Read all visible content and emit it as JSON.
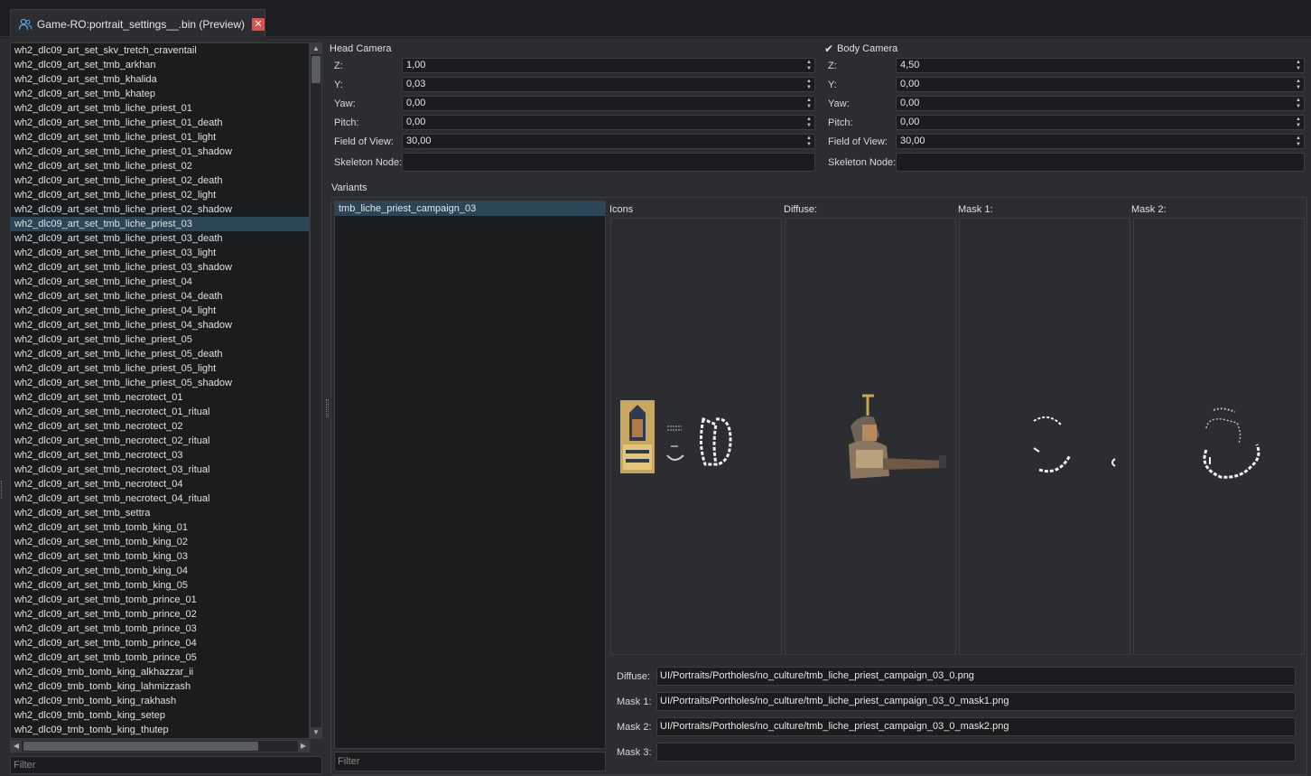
{
  "tab": {
    "title": "Game-RO:portrait_settings__.bin (Preview)",
    "icon": "people-icon",
    "close_glyph": "✕"
  },
  "list": {
    "selected_index": 12,
    "items": [
      "wh2_dlc09_art_set_skv_tretch_craventail",
      "wh2_dlc09_art_set_tmb_arkhan",
      "wh2_dlc09_art_set_tmb_khalida",
      "wh2_dlc09_art_set_tmb_khatep",
      "wh2_dlc09_art_set_tmb_liche_priest_01",
      "wh2_dlc09_art_set_tmb_liche_priest_01_death",
      "wh2_dlc09_art_set_tmb_liche_priest_01_light",
      "wh2_dlc09_art_set_tmb_liche_priest_01_shadow",
      "wh2_dlc09_art_set_tmb_liche_priest_02",
      "wh2_dlc09_art_set_tmb_liche_priest_02_death",
      "wh2_dlc09_art_set_tmb_liche_priest_02_light",
      "wh2_dlc09_art_set_tmb_liche_priest_02_shadow",
      "wh2_dlc09_art_set_tmb_liche_priest_03",
      "wh2_dlc09_art_set_tmb_liche_priest_03_death",
      "wh2_dlc09_art_set_tmb_liche_priest_03_light",
      "wh2_dlc09_art_set_tmb_liche_priest_03_shadow",
      "wh2_dlc09_art_set_tmb_liche_priest_04",
      "wh2_dlc09_art_set_tmb_liche_priest_04_death",
      "wh2_dlc09_art_set_tmb_liche_priest_04_light",
      "wh2_dlc09_art_set_tmb_liche_priest_04_shadow",
      "wh2_dlc09_art_set_tmb_liche_priest_05",
      "wh2_dlc09_art_set_tmb_liche_priest_05_death",
      "wh2_dlc09_art_set_tmb_liche_priest_05_light",
      "wh2_dlc09_art_set_tmb_liche_priest_05_shadow",
      "wh2_dlc09_art_set_tmb_necrotect_01",
      "wh2_dlc09_art_set_tmb_necrotect_01_ritual",
      "wh2_dlc09_art_set_tmb_necrotect_02",
      "wh2_dlc09_art_set_tmb_necrotect_02_ritual",
      "wh2_dlc09_art_set_tmb_necrotect_03",
      "wh2_dlc09_art_set_tmb_necrotect_03_ritual",
      "wh2_dlc09_art_set_tmb_necrotect_04",
      "wh2_dlc09_art_set_tmb_necrotect_04_ritual",
      "wh2_dlc09_art_set_tmb_settra",
      "wh2_dlc09_art_set_tmb_tomb_king_01",
      "wh2_dlc09_art_set_tmb_tomb_king_02",
      "wh2_dlc09_art_set_tmb_tomb_king_03",
      "wh2_dlc09_art_set_tmb_tomb_king_04",
      "wh2_dlc09_art_set_tmb_tomb_king_05",
      "wh2_dlc09_art_set_tmb_tomb_prince_01",
      "wh2_dlc09_art_set_tmb_tomb_prince_02",
      "wh2_dlc09_art_set_tmb_tomb_prince_03",
      "wh2_dlc09_art_set_tmb_tomb_prince_04",
      "wh2_dlc09_art_set_tmb_tomb_prince_05",
      "wh2_dlc09_tmb_tomb_king_alkhazzar_ii",
      "wh2_dlc09_tmb_tomb_king_lahmizzash",
      "wh2_dlc09_tmb_tomb_king_rakhash",
      "wh2_dlc09_tmb_tomb_king_setep",
      "wh2_dlc09_tmb_tomb_king_thutep"
    ],
    "filter_placeholder": "Filter"
  },
  "head_camera": {
    "title": "Head Camera",
    "fields": [
      {
        "label": "Z:",
        "value": "1,00"
      },
      {
        "label": "Y:",
        "value": "0,03"
      },
      {
        "label": "Yaw:",
        "value": "0,00"
      },
      {
        "label": "Pitch:",
        "value": "0,00"
      },
      {
        "label": "Field of View:",
        "value": "30,00"
      }
    ],
    "skeleton_label": "Skeleton Node:"
  },
  "body_camera": {
    "title": "Body Camera",
    "checked": true,
    "fields": [
      {
        "label": "Z:",
        "value": "4,50"
      },
      {
        "label": "Y:",
        "value": "0,00"
      },
      {
        "label": "Yaw:",
        "value": "0,00"
      },
      {
        "label": "Pitch:",
        "value": "0,00"
      },
      {
        "label": "Field of View:",
        "value": "30,00"
      }
    ],
    "skeleton_label": "Skeleton Node:"
  },
  "variants": {
    "title": "Variants",
    "items": [
      "tmb_liche_priest_campaign_03"
    ],
    "filter_placeholder": "Filter",
    "columns": [
      "Icons",
      "Diffuse:",
      "Mask 1:",
      "Mask 2:"
    ],
    "paths": [
      {
        "label": "Diffuse:",
        "value": "UI/Portraits/Portholes/no_culture/tmb_liche_priest_campaign_03_0.png"
      },
      {
        "label": "Mask 1:",
        "value": "UI/Portraits/Portholes/no_culture/tmb_liche_priest_campaign_03_0_mask1.png"
      },
      {
        "label": "Mask 2:",
        "value": "UI/Portraits/Portholes/no_culture/tmb_liche_priest_campaign_03_0_mask2.png"
      },
      {
        "label": "Mask 3:",
        "value": ""
      }
    ]
  },
  "colors": {
    "selection": "#2a4657",
    "background": "#2b2d30",
    "field": "#1b1c1e",
    "close": "#d9534f"
  }
}
